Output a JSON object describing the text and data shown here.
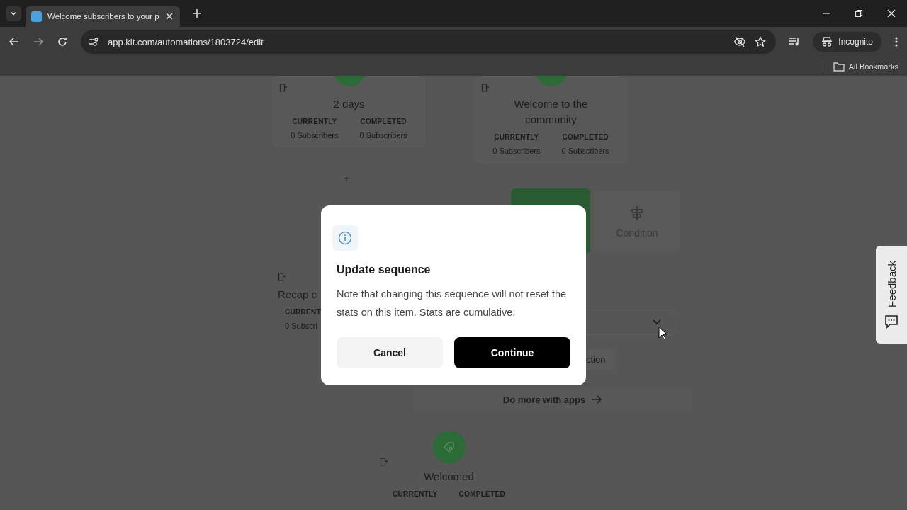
{
  "browser": {
    "tab": {
      "title": "Welcome subscribers to your p",
      "selected": true
    },
    "url": "app.kit.com/automations/1803724/edit",
    "profile": "Incognito",
    "bookmarks": "All Bookmarks"
  },
  "canvas": {
    "nodes": [
      {
        "kind": "badge-top",
        "title": "2 days",
        "stats": [
          {
            "label": "CURRENTLY",
            "value": "0 Subscribers"
          },
          {
            "label": "COMPLETED",
            "value": "0 Subscribers"
          }
        ]
      },
      {
        "kind": "badge-top",
        "title": "Welcome to the community",
        "stats": [
          {
            "label": "CURRENTLY",
            "value": "0 Subscribers"
          },
          {
            "label": "COMPLETED",
            "value": "0 Subscribers"
          }
        ]
      },
      {
        "kind": "plain",
        "title": "Recap c",
        "stats": [
          {
            "label": "CURRENT",
            "value": "0 Subscri"
          }
        ]
      },
      {
        "kind": "tag",
        "title": "Welcomed",
        "stats": [
          {
            "label": "CURRENTLY"
          },
          {
            "label": "COMPLETED"
          }
        ]
      }
    ],
    "add_step": "+",
    "condition_option": "Condition",
    "partial_button": "ction",
    "apps_link": "Do more with apps"
  },
  "dialog": {
    "title": "Update sequence",
    "message": "Note that changing this sequence will not reset the stats on this item. Stats are cumulative.",
    "buttons": [
      {
        "label": "Cancel",
        "kind": "secondary"
      },
      {
        "label": "Continue",
        "kind": "primary"
      }
    ]
  },
  "feedback": "Feedback"
}
